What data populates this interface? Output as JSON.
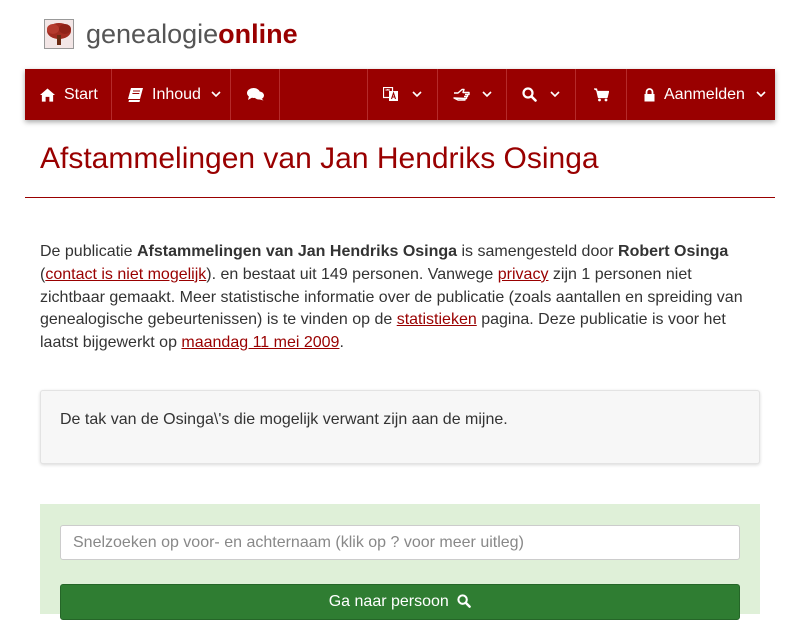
{
  "brand": {
    "name_plain": "genealogie",
    "name_accent": "online"
  },
  "nav": {
    "start_label": "Start",
    "contents_label": "Inhoud",
    "login_label": "Aanmelden"
  },
  "page": {
    "title": "Afstammelingen van Jan Hendriks Osinga"
  },
  "intro": {
    "t1": "De publicatie ",
    "pub_name": "Afstammelingen van Jan Hendriks Osinga",
    "t2": " is samengesteld door ",
    "author": "Robert Osinga",
    "t3": " (",
    "contact_link": "contact is niet mogelijk",
    "t4": "). en bestaat uit 149 personen. Vanwege ",
    "privacy_link": "privacy",
    "t5": " zijn 1 personen niet zichtbaar gemaakt. Meer statistische informatie over de publicatie (zoals aantallen en spreiding van genealogische gebeurtenissen) is te vinden op de ",
    "stats_link": "statistieken",
    "t6": " pagina. Deze publicatie is voor het laatst bijgewerkt op ",
    "date_link": "maandag 11 mei 2009",
    "t7": "."
  },
  "description": "De tak van de Osinga\\'s die mogelijk verwant zijn aan de mijne.",
  "search": {
    "placeholder": "Snelzoeken op voor- en achternaam (klik op ? voor meer uitleg)",
    "button_label": "Ga naar persoon"
  },
  "colors": {
    "brand": "#990000",
    "panel": "#dff0d8",
    "button": "#2f7d32"
  },
  "icons": [
    "tree-logo-icon",
    "home-icon",
    "book-icon",
    "comments-icon",
    "translate-icon",
    "hand-point-icon",
    "search-icon",
    "cart-icon",
    "lock-icon",
    "chevron-down-icon"
  ]
}
